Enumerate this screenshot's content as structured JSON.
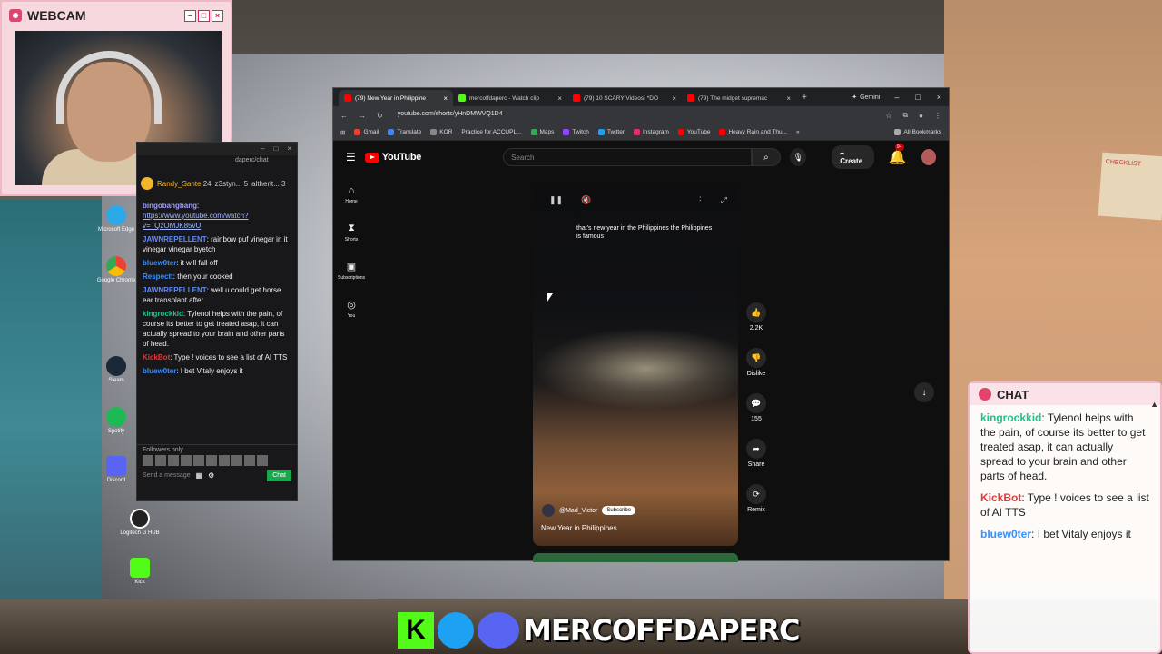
{
  "webcam": {
    "title": "WEBCAM"
  },
  "twitch_chat": {
    "url_fragment": "daperc/chat",
    "hype": [
      {
        "name": "Randy_Sante",
        "count": "24"
      },
      {
        "name": "z3styn...",
        "count": "5"
      },
      {
        "name": "altherit...",
        "count": "3"
      }
    ],
    "messages": [
      {
        "user": "bingobangbang",
        "text": "https://www.youtube.com/watch?v=_QzOMJK85vU",
        "color": "#a0a0ff",
        "link": true
      },
      {
        "user": "JAWNREPELLENT",
        "text": "rainbow puf vinegar in it vinegar vinegar byetch",
        "color": "#5d8bff"
      },
      {
        "user": "bluew0ter",
        "text": "it will fall off",
        "color": "#3a8fff"
      },
      {
        "user": "Respectt",
        "text": "then your cooked",
        "color": "#3a8fff"
      },
      {
        "user": "JAWNREPELLENT",
        "text": "well u could get horse ear transplant after",
        "color": "#5d8bff"
      },
      {
        "user": "kingrockkid",
        "text": "Tylenol helps with the pain, of course its better to get treated asap, it can actually spread to your brain and other parts of head.",
        "color": "#1fc28a"
      },
      {
        "user": "KickBot",
        "text": "Type ! voices to see a list of AI TTS",
        "color": "#e03b3b"
      },
      {
        "user": "bluew0ter",
        "text": "I bet Vitaly enjoys it",
        "color": "#3a8fff"
      }
    ],
    "followers_only": "Followers only",
    "input_placeholder": "Send a message",
    "chat_button": "Chat"
  },
  "browser": {
    "tabs": [
      {
        "label": "(79) New Year in Philippine",
        "fav": "youtube",
        "active": true
      },
      {
        "label": "mercoffdaperc - Watch clip",
        "fav": "kick",
        "active": false
      },
      {
        "label": "(79) 10 SCARY Videos! *DO",
        "fav": "youtube",
        "active": false
      },
      {
        "label": "(79) The midget supremac",
        "fav": "youtube",
        "active": false
      }
    ],
    "gemini": "Gemini",
    "url": "youtube.com/shorts/yHnDMWVQ1D4",
    "bookmarks": [
      "Gmail",
      "Translate",
      "KOR",
      "Practice for ACCUPL...",
      "Maps",
      "Twitch",
      "Twitter",
      "Instagram",
      "YouTube",
      "Heavy Rain and Thu..."
    ],
    "all_bookmarks": "All Bookmarks"
  },
  "youtube": {
    "logo": "YouTube",
    "search_placeholder": "Search",
    "create": "Create",
    "notifications": "9+",
    "guide": [
      {
        "label": "Home"
      },
      {
        "label": "Shorts"
      },
      {
        "label": "Subscriptions"
      },
      {
        "label": "You"
      }
    ],
    "short": {
      "caption": "that's new year in the Philippines the Philippines is famous",
      "channel": "@Mad_Victor",
      "subscribe": "Subscribe",
      "title": "New Year in Philippines"
    },
    "actions": [
      {
        "icon": "like-icon",
        "label": "2.2K"
      },
      {
        "icon": "dislike-icon",
        "label": "Dislike"
      },
      {
        "icon": "comment-icon",
        "label": "155"
      },
      {
        "icon": "share-icon",
        "label": "Share"
      },
      {
        "icon": "remix-icon",
        "label": "Remix"
      }
    ]
  },
  "chat_overlay": {
    "title": "CHAT",
    "messages": [
      {
        "user": "kingrockkid",
        "text": "Tylenol helps with the pain, of course its better to get treated asap, it can actually spread to your brain and other parts of head.",
        "color": "#1fc28a"
      },
      {
        "user": "KickBot",
        "text": "Type ! voices to see a list of AI TTS",
        "color": "#e03b3b"
      },
      {
        "user": "bluew0ter",
        "text": "I bet Vitaly enjoys it",
        "color": "#3a8fff"
      }
    ]
  },
  "brand": {
    "name": "MERCOFFDAPERC",
    "k": "K"
  },
  "desktop_icons": [
    {
      "label": "Microsoft Edge"
    },
    {
      "label": "Google Chrome"
    },
    {
      "label": "Steam"
    },
    {
      "label": "Spotify"
    },
    {
      "label": "Discord"
    },
    {
      "label": "Logitech G HUB"
    },
    {
      "label": "Kick"
    }
  ],
  "checklist_note": "CHECKLIST"
}
